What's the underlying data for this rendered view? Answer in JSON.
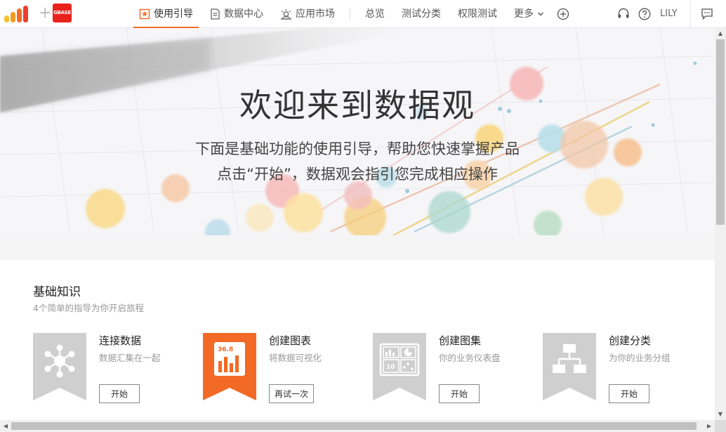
{
  "header": {
    "brand_logo": "gbase",
    "nav": [
      {
        "label": "使用引导",
        "icon": "guide-star-icon",
        "active": true
      },
      {
        "label": "数据中心",
        "icon": "document-icon"
      },
      {
        "label": "应用市场",
        "icon": "app-market-icon"
      }
    ],
    "links": [
      "总览",
      "测试分类",
      "权限测试"
    ],
    "more_label": "更多",
    "user_name": "LILY"
  },
  "hero": {
    "title": "欢迎来到数据观",
    "line1": "下面是基础功能的使用引导，帮助您快速掌握产品",
    "line2": "点击“开始”，数据观会指引您完成相应操作"
  },
  "basics": {
    "title": "基础知识",
    "subtitle": "4个简单的指导为你开启旅程",
    "cards": [
      {
        "title": "连接数据",
        "desc": "数据汇集在一起",
        "button": "开始",
        "icon": "network-nodes-icon",
        "color": "#cfcfcf"
      },
      {
        "title": "创建图表",
        "desc": "将数据可视化",
        "button": "再试一次",
        "icon": "bar-chart-icon",
        "color": "#f26a25",
        "chart_label": "36.8"
      },
      {
        "title": "创建图集",
        "desc": "你的业务仪表盘",
        "button": "开始",
        "icon": "dashboard-icon",
        "color": "#cfcfcf",
        "dashboard_label": "10"
      },
      {
        "title": "创建分类",
        "desc": "为你的业务分组",
        "button": "开始",
        "icon": "hierarchy-icon",
        "color": "#cfcfcf"
      }
    ]
  },
  "colors": {
    "accent": "#f06d2b",
    "brand_red": "#e8231d"
  }
}
